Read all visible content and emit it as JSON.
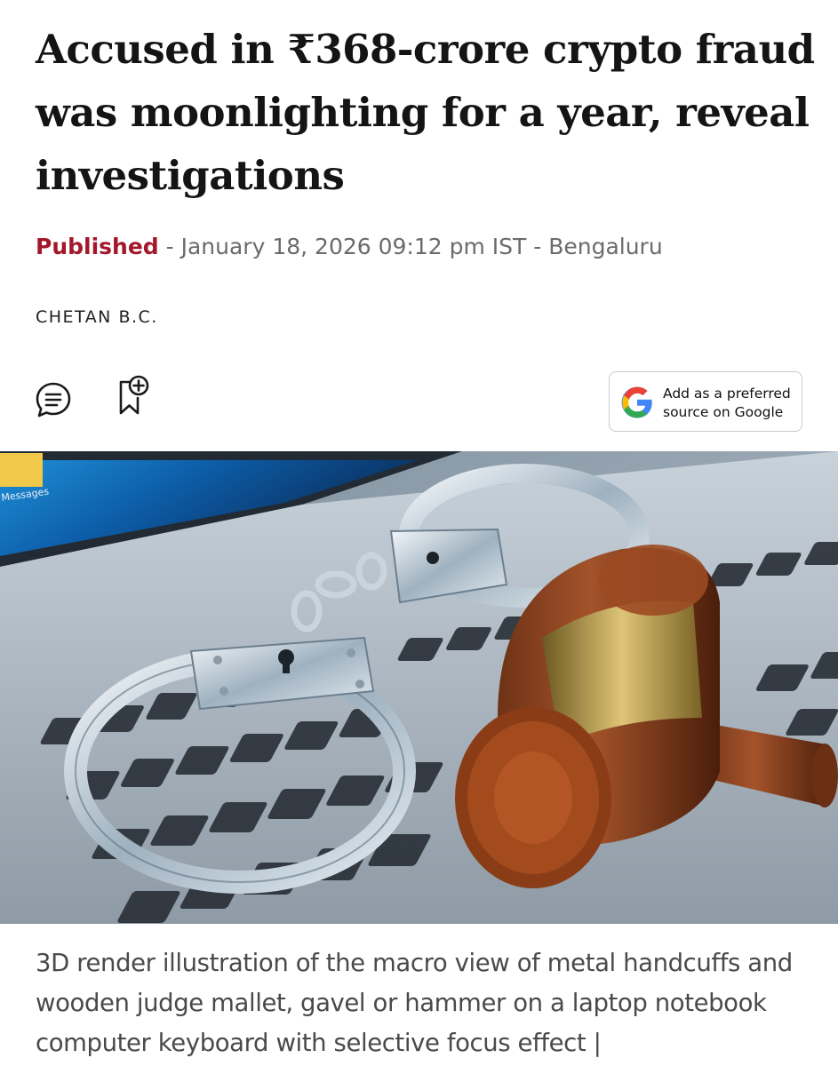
{
  "article": {
    "headline": "Accused in ₹368-crore crypto fraud was moonlighting for a year, reveal investigations",
    "published_label": "Published",
    "published_sep": " - ",
    "published_datetime": "January 18, 2026 09:12 pm IST",
    "location_sep": " - ",
    "location": "Bengaluru",
    "author": "CHETAN B.C.",
    "actions": {
      "comments_icon": "comment-icon",
      "bookmark_icon": "bookmark-add-icon",
      "google_button_line1": "Add as a preferred",
      "google_button_line2": "source on Google",
      "google_icon": "google-g-icon"
    },
    "hero_image": {
      "description_icon": "handcuffs-gavel-laptop-photo",
      "screen_label": "Messages"
    },
    "caption": "3D render illustration of the macro view of metal handcuffs and wooden judge mallet, gavel or hammer on a laptop notebook computer keyboard with selective focus effect |"
  },
  "colors": {
    "accent": "#a3172b",
    "meta_text": "#6b6b6b",
    "headline": "#141414",
    "caption": "#4a4a4a"
  }
}
